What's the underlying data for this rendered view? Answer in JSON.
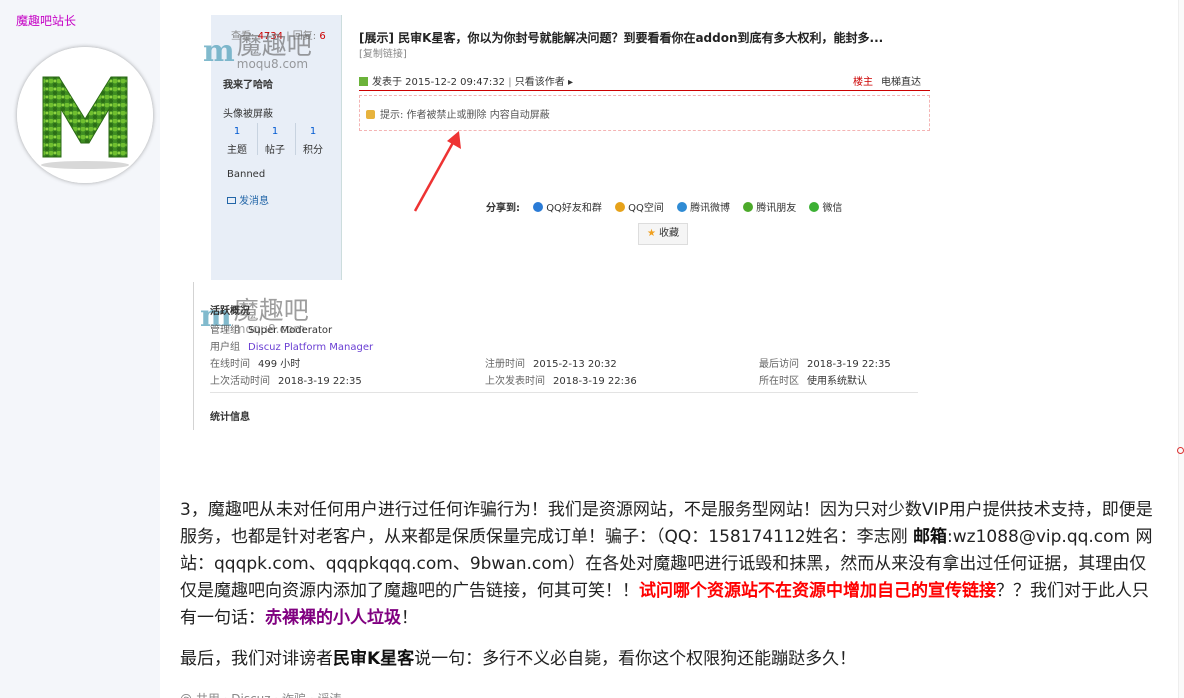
{
  "author": {
    "name": "魔趣吧站长"
  },
  "watermark": {
    "m": "m",
    "cn": "魔趣吧",
    "en": "moqu8.com"
  },
  "embedded": {
    "views_label": "查看:",
    "views": "4734",
    "replies_label": "回复:",
    "replies": "6",
    "copy_link": "[复制链接]",
    "title": "[展示] 民审K星客，你以为你封号就能解决问题？到要看看你在addon到底有多大权利，能封多...",
    "poster_name": "我来了哈哈",
    "post_time": "发表于 2015-12-2 09:47:32",
    "only_author": "只看该作者 ▸",
    "floor": "楼主",
    "direct": "电梯直达",
    "avatar_blocked": "头像被屏蔽",
    "stats": [
      {
        "num": "1",
        "label": "主题"
      },
      {
        "num": "1",
        "label": "帖子"
      },
      {
        "num": "1",
        "label": "积分"
      }
    ],
    "banned": "Banned",
    "send_msg": "发消息",
    "notice": "提示: 作者被禁止或删除 内容自动屏蔽",
    "share": {
      "label": "分享到:",
      "items": [
        {
          "name": "QQ好友和群",
          "color": "#2a7bd6"
        },
        {
          "name": "QQ空间",
          "color": "#e6a21a"
        },
        {
          "name": "腾讯微博",
          "color": "#2f8bd4"
        },
        {
          "name": "腾讯朋友",
          "color": "#4caa2a"
        },
        {
          "name": "微信",
          "color": "#3cb034"
        }
      ]
    },
    "favorite": "收藏",
    "activity": {
      "title": "活跃概况",
      "manager_group_label": "管理组",
      "manager_group": "Super Moderator",
      "user_group_label": "用户组",
      "user_group": "Discuz Platform Manager",
      "online_label": "在线时间",
      "online": "499 小时",
      "register_label": "注册时间",
      "register": "2015-2-13 20:32",
      "last_visit_label": "最后访问",
      "last_visit": "2018-3-19 22:35",
      "last_active_label": "上次活动时间",
      "last_active": "2018-3-19 22:35",
      "last_post_label": "上次发表时间",
      "last_post": "2018-3-19 22:36",
      "timezone_label": "所在时区",
      "timezone": "使用系统默认"
    },
    "stats_info": "统计信息"
  },
  "article": {
    "p1_a": "3，魔趣吧从未对任何用户进行过任何诈骗行为！我们是资源网站，不是服务型网站！因为只对少数VIP用户提供技术支持，即便是服务，也都是针对老客户，从来都是保质保量完成订单！骗子：（QQ：158174112姓名：李志刚 ",
    "p1_b": "邮箱",
    "p1_c": ":wz1088@vip.qq.com 网站：qqqpk.com、qqqpkqqq.com、9bwan.com）在各处对魔趣吧进行诋毁和抹黑，然而从来没有拿出过任何证据，其理由仅仅是魔趣吧向资源内添加了魔趣吧的广告链接，何其可笑！！",
    "p1_red": "试问哪个资源站不在资源中增加自己的宣传链接",
    "p1_d": "？？我们对于此人只有一句话：",
    "p1_purple": "赤裸裸的小人垃圾",
    "p1_e": "！",
    "p2_a": "最后，我们对诽谤者",
    "p2_strong": "民审K星客",
    "p2_b": "说一句：多行不义必自毙，看你这个权限狗还能蹦跶多久！",
    "footer": "@ 共用 · Discuz · 诈骗 · 谣涛"
  }
}
